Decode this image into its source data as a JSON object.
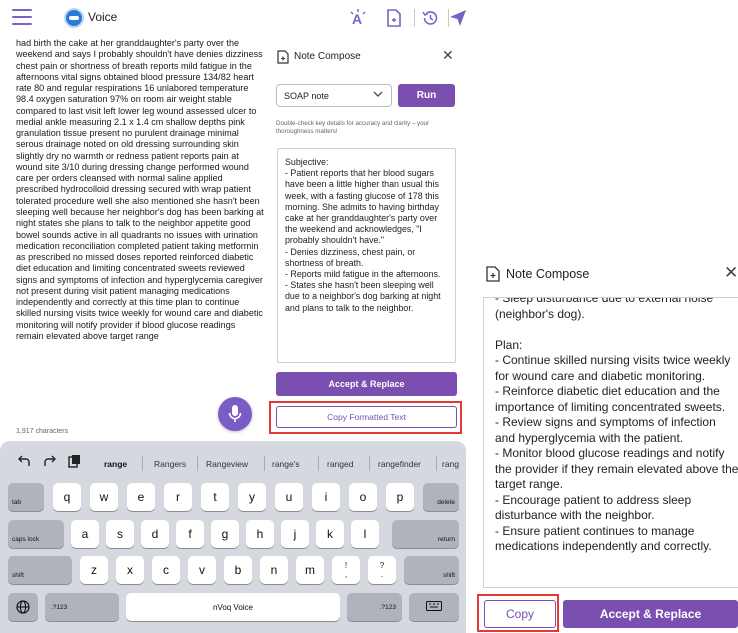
{
  "header": {
    "app_title": "Voice",
    "icons": [
      "menu-icon",
      "voice-logo-icon",
      "spellcheck-icon",
      "document-icon",
      "history-icon",
      "send-icon"
    ]
  },
  "dictation": {
    "text": "had birth the cake at her granddaughter's party over the weekend and says I probably shouldn't have denies dizziness chest pain or shortness of breath reports mild fatigue in the afternoons vital signs obtained blood pressure 134/82 heart rate 80 and regular respirations 16 unlabored temperature 98.4 oxygen saturation 97% on room air weight stable compared to last visit left lower leg wound assessed ulcer to medial ankle measuring 2.1 x 1.4 cm shallow depths pink granulation tissue present no purulent drainage minimal serous drainage noted on old dressing surrounding skin slightly dry no warmth or redness patient reports pain at wound site 3/10 during dressing change performed wound care per orders cleansed with normal saline applied prescribed hydrocolloid dressing secured with wrap patient tolerated procedure well she also mentioned she hasn't been sleeping well because her neighbor's dog has been barking at night states she plans to talk to the neighbor appetite good bowel sounds active in all quadrants no issues with urination medication reconciliation completed patient taking metformin as prescribed no missed doses reported reinforced diabetic diet education and limiting concentrated sweets reviewed signs and symptoms of infection and hyperglycemia caregiver not present during visit patient managing medications independently and correctly at this time plan to continue skilled nursing visits twice weekly for wound care and diabetic monitoring will notify provider if blood glucose readings remain elevated above target range",
    "char_count": "1,917 characters"
  },
  "compose_panel": {
    "title": "Note Compose",
    "close_label": "✕",
    "template_select": "SOAP note",
    "run_label": "Run",
    "hint": "Double-check key details for accuracy and clarity – your thoroughness matters!",
    "note_lines": [
      "Subjective:",
      "- Patient reports that her blood sugars have been a little higher than usual this week, with a fasting glucose of 178 this morning. She admits to having birthday cake at her granddaughter's party over the weekend and acknowledges, \"I probably shouldn't have.\"",
      "- Denies dizziness, chest pain, or shortness of breath.",
      "- Reports mild fatigue in the afternoons.",
      "- States she hasn't been sleeping well due to a neighbor's dog barking at night and plans to talk to the neighbor."
    ],
    "accept_label": "Accept & Replace",
    "copy_formatted_label": "Copy Formatted Text"
  },
  "keyboard": {
    "tools": [
      "undo-icon",
      "redo-icon",
      "clipboard-icon"
    ],
    "suggestions": [
      "range",
      "Rangers",
      "Rangeview",
      "range's",
      "ranged",
      "rangefinder",
      "rang"
    ],
    "row1": [
      "q",
      "w",
      "e",
      "r",
      "t",
      "y",
      "u",
      "i",
      "o",
      "p"
    ],
    "row2": [
      "a",
      "s",
      "d",
      "f",
      "g",
      "h",
      "j",
      "k",
      "l"
    ],
    "row3": [
      "z",
      "x",
      "c",
      "v",
      "b",
      "n",
      "m"
    ],
    "tab": "tab",
    "delete": "delete",
    "caps_lock": "caps lock",
    "return": "return",
    "shift": "shift",
    "punct1_top": "!",
    "punct1_bottom": ",",
    "punct2_top": "?",
    "punct2_bottom": ".",
    "numbers": ".?123",
    "space": "nVoq Voice"
  },
  "compose_panel_zoom": {
    "title": "Note Compose",
    "close_label": "✕",
    "note_lines": [
      "- Sleep disturbance due to external noise (neighbor's dog).",
      "",
      "Plan:",
      "- Continue skilled nursing visits twice weekly for wound care and diabetic monitoring.",
      "- Reinforce diabetic diet education and the importance of limiting concentrated sweets.",
      "- Review signs and symptoms of infection and hyperglycemia with the patient.",
      "- Monitor blood glucose readings and notify the provider if they remain elevated above the target range.",
      "- Encourage patient to address sleep disturbance with the neighbor.",
      "- Ensure patient continues to manage medications independently and correctly."
    ],
    "copy_label": "Copy",
    "accept_label": "Accept & Replace"
  },
  "colors": {
    "accent": "#7a4fb0",
    "highlight": "#e53935",
    "keyboard_bg": "#d5d8de"
  }
}
